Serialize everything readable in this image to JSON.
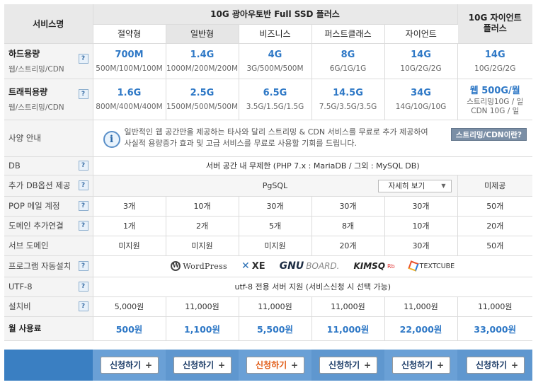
{
  "header": {
    "service_label": "서비스명",
    "group_title": "10G 광아우토반 Full SSD 플러스",
    "tabs": [
      "절약형",
      "일반형",
      "비즈니스",
      "퍼스트클래스",
      "자이언트"
    ],
    "zion_title": "10G 자이언트 플러스"
  },
  "qm": "?",
  "rows": {
    "disk": {
      "label": "하드용량",
      "sub": "웹/스트리밍/CDN",
      "values": [
        "700M",
        "1.4G",
        "4G",
        "8G",
        "14G",
        "14G"
      ],
      "details": [
        "500M/100M/100M",
        "1000M/200M/200M",
        "3G/500M/500M",
        "6G/1G/1G",
        "10G/2G/2G",
        "10G/2G/2G"
      ]
    },
    "traffic": {
      "label": "트래픽용량",
      "sub": "웹/스트리밍/CDN",
      "values": [
        "1.6G",
        "2.5G",
        "6.5G",
        "14.5G",
        "34G",
        "웹 500G/월"
      ],
      "details": [
        "800M/400M/400M",
        "1500M/500M/500M",
        "3.5G/1.5G/1.5G",
        "7.5G/3.5G/3.5G",
        "14G/10G/10G",
        "스트리밍10G / 일 CDN 10G / 일"
      ]
    },
    "spec": {
      "label": "사양 안내",
      "info_icon": "i",
      "text": "일반적인 웹 공간만을 제공하는 타사와 달리 스트리밍 & CDN 서비스를 무료로 추가 제공하여 사실적 용량증가 효과 및 고급 서비스를 무료로 사용할 기회를 드립니다.",
      "cdn_button": "스트리밍/CDN이란?"
    },
    "db": {
      "label": "DB",
      "value": "서버 공간 내 무제한 (PHP 7.x : MariaDB / 그외 : MySQL DB)"
    },
    "db_option": {
      "label": "추가 DB옵션 제공",
      "value": "PgSQL",
      "select": "자세히 보기",
      "zion": "미제공"
    },
    "pop": {
      "label": "POP 메일 계정",
      "values": [
        "3개",
        "10개",
        "30개",
        "30개",
        "30개",
        "50개"
      ]
    },
    "domain": {
      "label": "도메인 추가연결",
      "values": [
        "1개",
        "2개",
        "5개",
        "8개",
        "10개",
        "20개"
      ]
    },
    "subdomain": {
      "label": "서브 도메인",
      "values": [
        "미지원",
        "미지원",
        "미지원",
        "20개",
        "30개",
        "50개"
      ]
    },
    "auto_install": {
      "label": "프로그램 자동설치",
      "logos": {
        "wordpress": "WordPress",
        "xe": "XE",
        "gnuboard_a": "GNU",
        "gnuboard_b": "BOARD.",
        "kimsq_a": "KIMSQ",
        "kimsq_b": "Rb",
        "textcube": "TEXTCUBE"
      }
    },
    "utf8": {
      "label": "UTF-8",
      "value": "utf-8 전용 서버 지원 (서비스신청 시 선택 가능)"
    },
    "setup": {
      "label": "설치비",
      "values": [
        "5,000원",
        "11,000원",
        "11,000원",
        "11,000원",
        "11,000원",
        "11,000원"
      ]
    },
    "monthly": {
      "label": "월 사용료",
      "values": [
        "500원",
        "1,100원",
        "5,500원",
        "11,000원",
        "22,000원",
        "33,000원"
      ]
    }
  },
  "apply_label": "신청하기",
  "apply_plus": "+",
  "colors": {
    "accent": "#2e78c6",
    "bar": "#3a7fc2",
    "orange": "#e05a14"
  }
}
